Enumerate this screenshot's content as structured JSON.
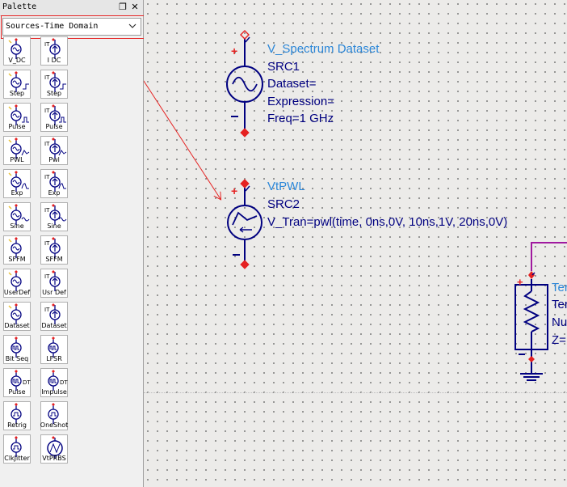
{
  "palette": {
    "title": "Palette",
    "category": "Sources-Time Domain",
    "items": [
      {
        "label": "V_DC",
        "icon": "voltage-dc-icon"
      },
      {
        "label": "I DC",
        "icon": "current-dc-icon"
      },
      {
        "label": "Step",
        "icon": "voltage-step-icon"
      },
      {
        "label": "Step",
        "icon": "current-step-icon"
      },
      {
        "label": "Pulse",
        "icon": "voltage-pulse-icon"
      },
      {
        "label": "Pulse",
        "icon": "current-pulse-icon"
      },
      {
        "label": "PWL",
        "icon": "voltage-pwl-icon"
      },
      {
        "label": "Pwl",
        "icon": "current-pwl-icon"
      },
      {
        "label": "Exp",
        "icon": "voltage-exp-icon"
      },
      {
        "label": "Exp",
        "icon": "current-exp-icon"
      },
      {
        "label": "Sine",
        "icon": "voltage-sine-icon"
      },
      {
        "label": "Sine",
        "icon": "current-sine-icon"
      },
      {
        "label": "SFFM",
        "icon": "voltage-sffm-icon"
      },
      {
        "label": "SFFM",
        "icon": "current-sffm-icon"
      },
      {
        "label": "UserDef",
        "icon": "voltage-userdef-icon"
      },
      {
        "label": "Usr Def",
        "icon": "current-userdef-icon"
      },
      {
        "label": "Dataset",
        "icon": "voltage-dataset-icon"
      },
      {
        "label": "Dataset",
        "icon": "current-dataset-icon"
      },
      {
        "label": "Bit Seq",
        "icon": "bitseq-icon"
      },
      {
        "label": "LFSR",
        "icon": "lfsr-icon"
      },
      {
        "label": "Pulse",
        "icon": "dt-pulse-icon"
      },
      {
        "label": "Impulse",
        "icon": "dt-impulse-icon"
      },
      {
        "label": "Retrig",
        "icon": "retrig-icon"
      },
      {
        "label": "OneShot",
        "icon": "oneshot-icon"
      },
      {
        "label": "ClkJitter",
        "icon": "clkjitter-icon"
      },
      {
        "label": "VtPRBS",
        "icon": "vtprbs-icon"
      }
    ]
  },
  "schematic": {
    "src1": {
      "name": "V_Spectrum Dataset",
      "id": "SRC1",
      "params": [
        "Dataset=",
        "Expression=",
        "Freq=1 GHz"
      ]
    },
    "src2": {
      "name": "VtPWL",
      "id": "SRC2",
      "params": [
        "V_Tran=pwl(time, 0ns,0V, 10ns,1V, 20ns,0V)"
      ]
    },
    "term": {
      "name": "Ter",
      "id": "Ter",
      "params": [
        "Nu",
        "Z="
      ]
    }
  },
  "colors": {
    "component": "#000080",
    "wire": "#a0199f",
    "pin": "#e52121",
    "label_blue": "#2a86d8",
    "annotation": "#e52121"
  }
}
